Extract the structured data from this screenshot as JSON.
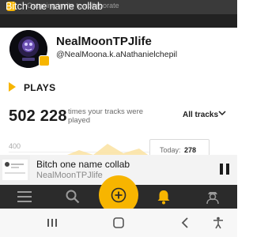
{
  "notification": {
    "text": "Outgoing invite to collaborate"
  },
  "window": {
    "title": "Bitch one name collab"
  },
  "profile": {
    "name": "NealMoonTPJlife",
    "handle": "@NealMoona.k.aNathanielchepil"
  },
  "plays": {
    "section_title": "PLAYS",
    "count": "502 228",
    "caption": "times your tracks were played",
    "filter_label": "All tracks",
    "chart_tick": "400",
    "today_label": "Today:",
    "today_value": "278"
  },
  "player": {
    "title": "Bitch one name collab",
    "artist": "NealMoonTPJlife",
    "state": "playing"
  },
  "nav": {
    "items": [
      "menu-icon",
      "search-icon",
      "add-icon",
      "bell-icon",
      "profile-icon"
    ],
    "active": "bell-icon"
  },
  "system_nav": {
    "items": [
      "recent-apps-icon",
      "home-icon",
      "back-icon",
      "accessibility-icon"
    ]
  },
  "colors": {
    "accent": "#f7b500",
    "dark": "#2b2b2b",
    "title_bar": "#222222"
  }
}
